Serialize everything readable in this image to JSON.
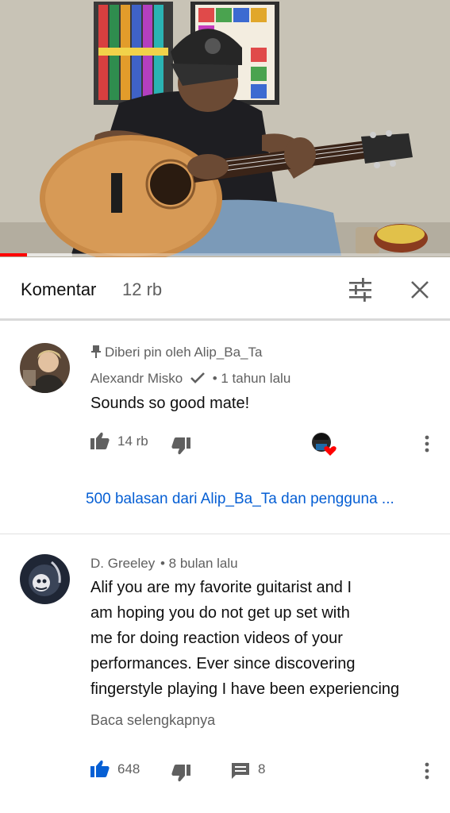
{
  "header": {
    "title": "Komentar",
    "count": "12 rb"
  },
  "video": {
    "progress_fraction": 0.06,
    "buffer_fraction": 0.16
  },
  "comments": [
    {
      "pinned_label": "Diberi pin oleh Alip_Ba_Ta",
      "author": "Alexandr Misko",
      "verified": true,
      "time": "• 1 tahun lalu",
      "text": "Sounds so good mate!",
      "likes": "14 rb",
      "replies_link": "500 balasan dari Alip_Ba_Ta dan pengguna ..."
    },
    {
      "author": "D. Greeley",
      "time": "• 8 bulan lalu",
      "text_lines": [
        "Alif you are my favorite guitarist and I",
        "am hoping you do not get up set with",
        "me for doing reaction videos of your",
        "performances. Ever since discovering",
        "fingerstyle playing I have been experiencing"
      ],
      "read_more": "Baca selengkapnya",
      "likes": "648",
      "reply_count": "8"
    }
  ],
  "colors": {
    "link": "#065fd4",
    "like_active": "#065fd4",
    "heart": "#ff0000",
    "meta_text": "#606060"
  }
}
